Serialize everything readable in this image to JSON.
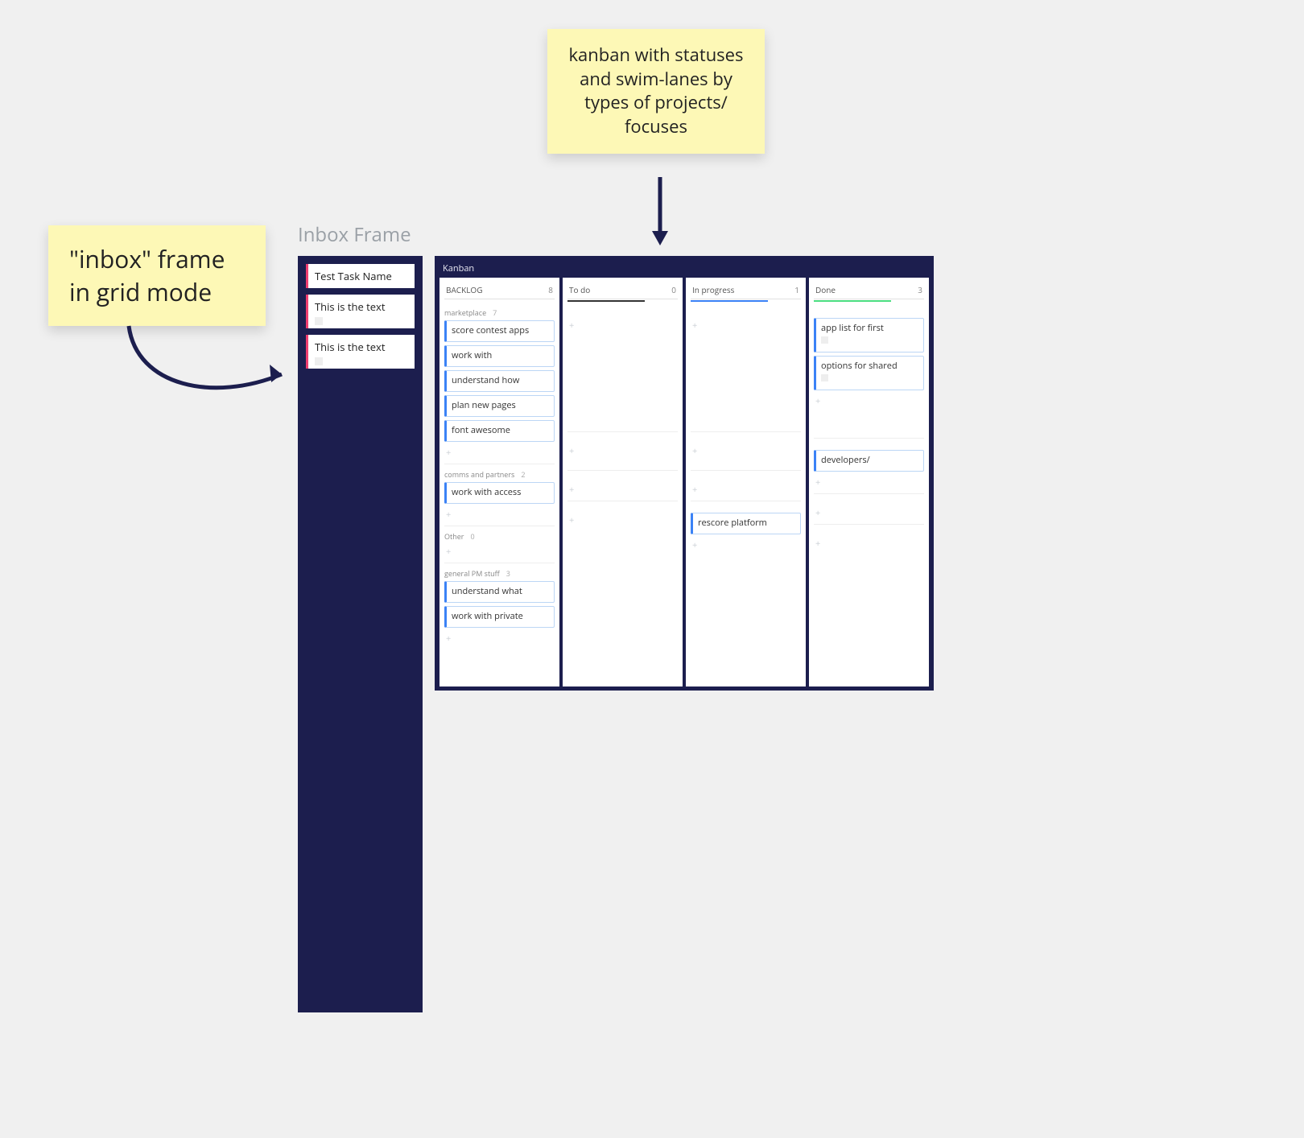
{
  "stickies": {
    "left": "\"inbox\" frame in grid mode",
    "top": "kanban with statuses and swim-lanes by types of projects/ focuses"
  },
  "inbox": {
    "frame_label": "Inbox Frame",
    "cards": [
      {
        "text": "Test Task Name",
        "tall": false
      },
      {
        "text": "This is the text",
        "tall": true
      },
      {
        "text": "This is the text",
        "tall": true
      }
    ]
  },
  "kanban": {
    "title": "Kanban",
    "columns": [
      {
        "name": "BACKLOG",
        "count": 8,
        "underline": ""
      },
      {
        "name": "To do",
        "count": 0,
        "underline": "ul-black"
      },
      {
        "name": "In progress",
        "count": 1,
        "underline": "ul-blue"
      },
      {
        "name": "Done",
        "count": 3,
        "underline": "ul-green"
      }
    ],
    "lanes": [
      {
        "name": "marketplace",
        "count": 7,
        "cells": {
          "backlog": [
            "score contest apps",
            "work with",
            "understand how",
            "plan new pages",
            "font awesome"
          ],
          "todo": [],
          "inprogress": [],
          "done": [
            "app list for first",
            "options for shared"
          ]
        }
      },
      {
        "name": "comms and partners",
        "count": 2,
        "cells": {
          "backlog": [
            "work with access"
          ],
          "todo": [],
          "inprogress": [],
          "done": [
            "developers/"
          ]
        }
      },
      {
        "name": "Other",
        "count": 0,
        "cells": {
          "backlog": [],
          "todo": [],
          "inprogress": [],
          "done": []
        }
      },
      {
        "name": "general PM stuff",
        "count": 3,
        "cells": {
          "backlog": [
            "understand what",
            "work with private"
          ],
          "todo": [],
          "inprogress": [
            "rescore platform"
          ],
          "done": []
        }
      }
    ]
  }
}
